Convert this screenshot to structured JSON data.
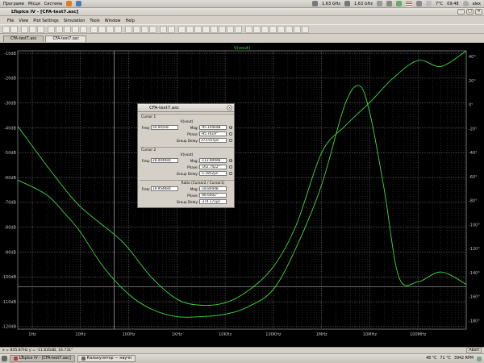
{
  "system_bar": {
    "menus": [
      "Програми",
      "Місця",
      "Система"
    ],
    "cpu1": "1,63 GHz",
    "cpu2": "1,63 GHz",
    "temperature": "7°C",
    "time": "09:48",
    "user": "alex"
  },
  "window": {
    "title": "LTspice IV - [CFA-test7.asc]"
  },
  "menubar": [
    "File",
    "View",
    "Plot Settings",
    "Simulation",
    "Tools",
    "Window",
    "Help"
  ],
  "tabs": [
    {
      "label": "CFA-test7.asc",
      "active": false
    },
    {
      "label": "CFA-test7.asc",
      "active": true
    }
  ],
  "plot": {
    "trace_label": "V(vout)",
    "left_ticks": [
      "-10dB",
      "-20dB",
      "-30dB",
      "-40dB",
      "-50dB",
      "-60dB",
      "-70dB",
      "-80dB",
      "-90dB",
      "-100dB",
      "-110dB",
      "-120dB"
    ],
    "right_ticks": [
      "40°",
      "20°",
      "0°",
      "-20°",
      "-40°",
      "-60°",
      "-80°",
      "-100°",
      "-120°",
      "-140°",
      "-160°",
      "-180°"
    ],
    "x_ticks": [
      "1Hz",
      "10Hz",
      "100Hz",
      "1KHz",
      "10KHz",
      "100KHz",
      "1MHz",
      "10MHz",
      "100MHz"
    ],
    "colors": {
      "background": "#000000",
      "grid": "#8a8a8a",
      "trace": "#3fdc3f",
      "cursor": "#cfcfcf"
    }
  },
  "chart_data": {
    "type": "line",
    "x_scale": "log",
    "x_range": [
      0.5,
      1000000000
    ],
    "ylim_left_db": [
      -121,
      -9
    ],
    "ylim_right_deg": [
      -187,
      45
    ],
    "series": [
      {
        "name": "V(vout) magnitude",
        "axis": "left",
        "x": [
          0.5,
          2,
          5,
          10,
          30,
          100,
          300,
          1000,
          3000,
          10000,
          30000,
          100000,
          300000,
          1000000,
          3000000,
          6000000,
          10000000,
          20000000,
          40000000,
          100000000,
          300000000,
          1000000000
        ],
        "y": [
          -61,
          -67,
          -75,
          -82,
          -96,
          -107,
          -113,
          -116,
          -116,
          -115,
          -112,
          -105,
          -88,
          -63,
          -31,
          -23,
          -34,
          -65,
          -100,
          -102,
          -98,
          -103
        ]
      },
      {
        "name": "V(vout) phase",
        "axis": "right",
        "x": [
          0.5,
          3,
          10,
          50,
          100,
          300,
          1000,
          3000,
          10000,
          30000,
          100000,
          300000,
          1000000,
          3000000,
          10000000,
          30000000,
          100000000,
          300000000,
          1000000000
        ],
        "y": [
          -18,
          -60,
          -85,
          -108,
          -120,
          -144,
          -162,
          -167,
          -165,
          -155,
          -135,
          -100,
          -40,
          -18,
          2,
          22,
          37,
          32,
          45
        ]
      }
    ],
    "cursors": [
      {
        "name": "Cursor 1",
        "x_freq": 50
      }
    ],
    "horizontal_marker_db": -104
  },
  "dialog": {
    "title": "CFA-test7.asc",
    "cursor1": {
      "label": "Cursor 1",
      "signal": "V(vout)",
      "freq": "50.005Hz",
      "mag": "-95.1046dB",
      "phase": "-95.7619°",
      "group_delay": "373.015µs"
    },
    "cursor2": {
      "label": "Cursor 2",
      "signal": "V(vout)",
      "freq": "28.004KHz",
      "mag": "-113.909dB",
      "phase": "-162.7422°",
      "group_delay": "-1.1852µs"
    },
    "ratio": {
      "label": "Ratio (Cursor2 / Cursor1)",
      "freq": "19.954KHz",
      "mag": "-18.804dB",
      "phase": "-66.6602°",
      "group_delay": "-374.171µs"
    },
    "labels": {
      "freq": "Freq:",
      "mag": "Mag:",
      "phase": "Phase:",
      "group_delay": "Group Delay:"
    }
  },
  "status": {
    "text": "x = 845.87Hz   y = -11.635dB, 16.731°",
    "right": "Abort"
  },
  "taskbar": {
    "items": [
      {
        "label": "LTspice IV - [CFA-test7.asc]",
        "active": true
      },
      {
        "label": "Калькулятор — научн",
        "active": false
      }
    ],
    "tray": [
      "48 °C",
      "71 °C",
      "3942 RPM"
    ]
  }
}
